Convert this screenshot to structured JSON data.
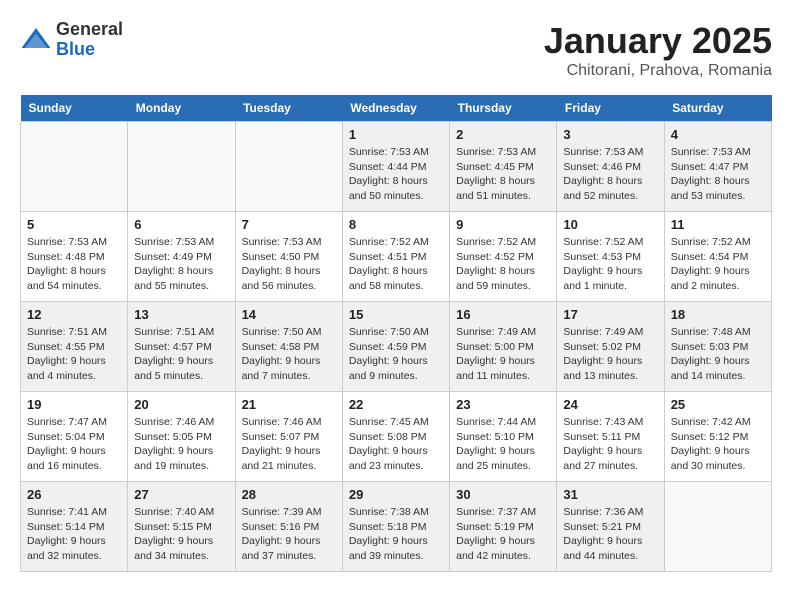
{
  "logo": {
    "general": "General",
    "blue": "Blue"
  },
  "title": "January 2025",
  "location": "Chitorani, Prahova, Romania",
  "weekdays": [
    "Sunday",
    "Monday",
    "Tuesday",
    "Wednesday",
    "Thursday",
    "Friday",
    "Saturday"
  ],
  "weeks": [
    [
      {
        "day": "",
        "info": ""
      },
      {
        "day": "",
        "info": ""
      },
      {
        "day": "",
        "info": ""
      },
      {
        "day": "1",
        "info": "Sunrise: 7:53 AM\nSunset: 4:44 PM\nDaylight: 8 hours\nand 50 minutes."
      },
      {
        "day": "2",
        "info": "Sunrise: 7:53 AM\nSunset: 4:45 PM\nDaylight: 8 hours\nand 51 minutes."
      },
      {
        "day": "3",
        "info": "Sunrise: 7:53 AM\nSunset: 4:46 PM\nDaylight: 8 hours\nand 52 minutes."
      },
      {
        "day": "4",
        "info": "Sunrise: 7:53 AM\nSunset: 4:47 PM\nDaylight: 8 hours\nand 53 minutes."
      }
    ],
    [
      {
        "day": "5",
        "info": "Sunrise: 7:53 AM\nSunset: 4:48 PM\nDaylight: 8 hours\nand 54 minutes."
      },
      {
        "day": "6",
        "info": "Sunrise: 7:53 AM\nSunset: 4:49 PM\nDaylight: 8 hours\nand 55 minutes."
      },
      {
        "day": "7",
        "info": "Sunrise: 7:53 AM\nSunset: 4:50 PM\nDaylight: 8 hours\nand 56 minutes."
      },
      {
        "day": "8",
        "info": "Sunrise: 7:52 AM\nSunset: 4:51 PM\nDaylight: 8 hours\nand 58 minutes."
      },
      {
        "day": "9",
        "info": "Sunrise: 7:52 AM\nSunset: 4:52 PM\nDaylight: 8 hours\nand 59 minutes."
      },
      {
        "day": "10",
        "info": "Sunrise: 7:52 AM\nSunset: 4:53 PM\nDaylight: 9 hours\nand 1 minute."
      },
      {
        "day": "11",
        "info": "Sunrise: 7:52 AM\nSunset: 4:54 PM\nDaylight: 9 hours\nand 2 minutes."
      }
    ],
    [
      {
        "day": "12",
        "info": "Sunrise: 7:51 AM\nSunset: 4:55 PM\nDaylight: 9 hours\nand 4 minutes."
      },
      {
        "day": "13",
        "info": "Sunrise: 7:51 AM\nSunset: 4:57 PM\nDaylight: 9 hours\nand 5 minutes."
      },
      {
        "day": "14",
        "info": "Sunrise: 7:50 AM\nSunset: 4:58 PM\nDaylight: 9 hours\nand 7 minutes."
      },
      {
        "day": "15",
        "info": "Sunrise: 7:50 AM\nSunset: 4:59 PM\nDaylight: 9 hours\nand 9 minutes."
      },
      {
        "day": "16",
        "info": "Sunrise: 7:49 AM\nSunset: 5:00 PM\nDaylight: 9 hours\nand 11 minutes."
      },
      {
        "day": "17",
        "info": "Sunrise: 7:49 AM\nSunset: 5:02 PM\nDaylight: 9 hours\nand 13 minutes."
      },
      {
        "day": "18",
        "info": "Sunrise: 7:48 AM\nSunset: 5:03 PM\nDaylight: 9 hours\nand 14 minutes."
      }
    ],
    [
      {
        "day": "19",
        "info": "Sunrise: 7:47 AM\nSunset: 5:04 PM\nDaylight: 9 hours\nand 16 minutes."
      },
      {
        "day": "20",
        "info": "Sunrise: 7:46 AM\nSunset: 5:05 PM\nDaylight: 9 hours\nand 19 minutes."
      },
      {
        "day": "21",
        "info": "Sunrise: 7:46 AM\nSunset: 5:07 PM\nDaylight: 9 hours\nand 21 minutes."
      },
      {
        "day": "22",
        "info": "Sunrise: 7:45 AM\nSunset: 5:08 PM\nDaylight: 9 hours\nand 23 minutes."
      },
      {
        "day": "23",
        "info": "Sunrise: 7:44 AM\nSunset: 5:10 PM\nDaylight: 9 hours\nand 25 minutes."
      },
      {
        "day": "24",
        "info": "Sunrise: 7:43 AM\nSunset: 5:11 PM\nDaylight: 9 hours\nand 27 minutes."
      },
      {
        "day": "25",
        "info": "Sunrise: 7:42 AM\nSunset: 5:12 PM\nDaylight: 9 hours\nand 30 minutes."
      }
    ],
    [
      {
        "day": "26",
        "info": "Sunrise: 7:41 AM\nSunset: 5:14 PM\nDaylight: 9 hours\nand 32 minutes."
      },
      {
        "day": "27",
        "info": "Sunrise: 7:40 AM\nSunset: 5:15 PM\nDaylight: 9 hours\nand 34 minutes."
      },
      {
        "day": "28",
        "info": "Sunrise: 7:39 AM\nSunset: 5:16 PM\nDaylight: 9 hours\nand 37 minutes."
      },
      {
        "day": "29",
        "info": "Sunrise: 7:38 AM\nSunset: 5:18 PM\nDaylight: 9 hours\nand 39 minutes."
      },
      {
        "day": "30",
        "info": "Sunrise: 7:37 AM\nSunset: 5:19 PM\nDaylight: 9 hours\nand 42 minutes."
      },
      {
        "day": "31",
        "info": "Sunrise: 7:36 AM\nSunset: 5:21 PM\nDaylight: 9 hours\nand 44 minutes."
      },
      {
        "day": "",
        "info": ""
      }
    ]
  ]
}
